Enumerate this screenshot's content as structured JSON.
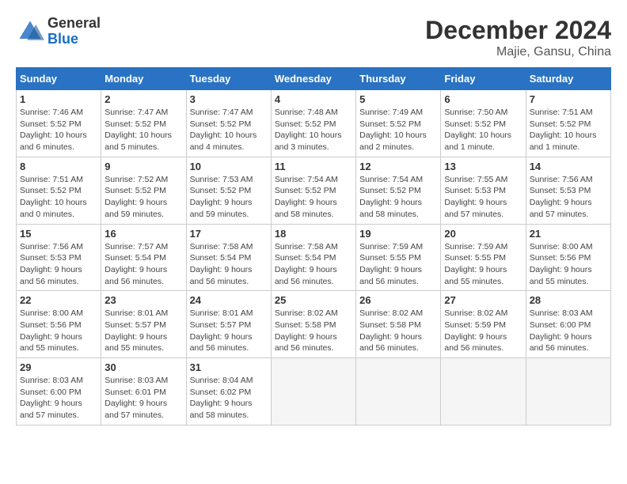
{
  "header": {
    "logo_general": "General",
    "logo_blue": "Blue",
    "month_year": "December 2024",
    "location": "Majie, Gansu, China"
  },
  "days_of_week": [
    "Sunday",
    "Monday",
    "Tuesday",
    "Wednesday",
    "Thursday",
    "Friday",
    "Saturday"
  ],
  "weeks": [
    [
      {
        "day": "1",
        "info": "Sunrise: 7:46 AM\nSunset: 5:52 PM\nDaylight: 10 hours\nand 6 minutes."
      },
      {
        "day": "2",
        "info": "Sunrise: 7:47 AM\nSunset: 5:52 PM\nDaylight: 10 hours\nand 5 minutes."
      },
      {
        "day": "3",
        "info": "Sunrise: 7:47 AM\nSunset: 5:52 PM\nDaylight: 10 hours\nand 4 minutes."
      },
      {
        "day": "4",
        "info": "Sunrise: 7:48 AM\nSunset: 5:52 PM\nDaylight: 10 hours\nand 3 minutes."
      },
      {
        "day": "5",
        "info": "Sunrise: 7:49 AM\nSunset: 5:52 PM\nDaylight: 10 hours\nand 2 minutes."
      },
      {
        "day": "6",
        "info": "Sunrise: 7:50 AM\nSunset: 5:52 PM\nDaylight: 10 hours\nand 1 minute."
      },
      {
        "day": "7",
        "info": "Sunrise: 7:51 AM\nSunset: 5:52 PM\nDaylight: 10 hours\nand 1 minute."
      }
    ],
    [
      {
        "day": "8",
        "info": "Sunrise: 7:51 AM\nSunset: 5:52 PM\nDaylight: 10 hours\nand 0 minutes."
      },
      {
        "day": "9",
        "info": "Sunrise: 7:52 AM\nSunset: 5:52 PM\nDaylight: 9 hours\nand 59 minutes."
      },
      {
        "day": "10",
        "info": "Sunrise: 7:53 AM\nSunset: 5:52 PM\nDaylight: 9 hours\nand 59 minutes."
      },
      {
        "day": "11",
        "info": "Sunrise: 7:54 AM\nSunset: 5:52 PM\nDaylight: 9 hours\nand 58 minutes."
      },
      {
        "day": "12",
        "info": "Sunrise: 7:54 AM\nSunset: 5:52 PM\nDaylight: 9 hours\nand 58 minutes."
      },
      {
        "day": "13",
        "info": "Sunrise: 7:55 AM\nSunset: 5:53 PM\nDaylight: 9 hours\nand 57 minutes."
      },
      {
        "day": "14",
        "info": "Sunrise: 7:56 AM\nSunset: 5:53 PM\nDaylight: 9 hours\nand 57 minutes."
      }
    ],
    [
      {
        "day": "15",
        "info": "Sunrise: 7:56 AM\nSunset: 5:53 PM\nDaylight: 9 hours\nand 56 minutes."
      },
      {
        "day": "16",
        "info": "Sunrise: 7:57 AM\nSunset: 5:54 PM\nDaylight: 9 hours\nand 56 minutes."
      },
      {
        "day": "17",
        "info": "Sunrise: 7:58 AM\nSunset: 5:54 PM\nDaylight: 9 hours\nand 56 minutes."
      },
      {
        "day": "18",
        "info": "Sunrise: 7:58 AM\nSunset: 5:54 PM\nDaylight: 9 hours\nand 56 minutes."
      },
      {
        "day": "19",
        "info": "Sunrise: 7:59 AM\nSunset: 5:55 PM\nDaylight: 9 hours\nand 56 minutes."
      },
      {
        "day": "20",
        "info": "Sunrise: 7:59 AM\nSunset: 5:55 PM\nDaylight: 9 hours\nand 55 minutes."
      },
      {
        "day": "21",
        "info": "Sunrise: 8:00 AM\nSunset: 5:56 PM\nDaylight: 9 hours\nand 55 minutes."
      }
    ],
    [
      {
        "day": "22",
        "info": "Sunrise: 8:00 AM\nSunset: 5:56 PM\nDaylight: 9 hours\nand 55 minutes."
      },
      {
        "day": "23",
        "info": "Sunrise: 8:01 AM\nSunset: 5:57 PM\nDaylight: 9 hours\nand 55 minutes."
      },
      {
        "day": "24",
        "info": "Sunrise: 8:01 AM\nSunset: 5:57 PM\nDaylight: 9 hours\nand 56 minutes."
      },
      {
        "day": "25",
        "info": "Sunrise: 8:02 AM\nSunset: 5:58 PM\nDaylight: 9 hours\nand 56 minutes."
      },
      {
        "day": "26",
        "info": "Sunrise: 8:02 AM\nSunset: 5:58 PM\nDaylight: 9 hours\nand 56 minutes."
      },
      {
        "day": "27",
        "info": "Sunrise: 8:02 AM\nSunset: 5:59 PM\nDaylight: 9 hours\nand 56 minutes."
      },
      {
        "day": "28",
        "info": "Sunrise: 8:03 AM\nSunset: 6:00 PM\nDaylight: 9 hours\nand 56 minutes."
      }
    ],
    [
      {
        "day": "29",
        "info": "Sunrise: 8:03 AM\nSunset: 6:00 PM\nDaylight: 9 hours\nand 57 minutes."
      },
      {
        "day": "30",
        "info": "Sunrise: 8:03 AM\nSunset: 6:01 PM\nDaylight: 9 hours\nand 57 minutes."
      },
      {
        "day": "31",
        "info": "Sunrise: 8:04 AM\nSunset: 6:02 PM\nDaylight: 9 hours\nand 58 minutes."
      },
      {
        "day": "",
        "info": ""
      },
      {
        "day": "",
        "info": ""
      },
      {
        "day": "",
        "info": ""
      },
      {
        "day": "",
        "info": ""
      }
    ]
  ]
}
